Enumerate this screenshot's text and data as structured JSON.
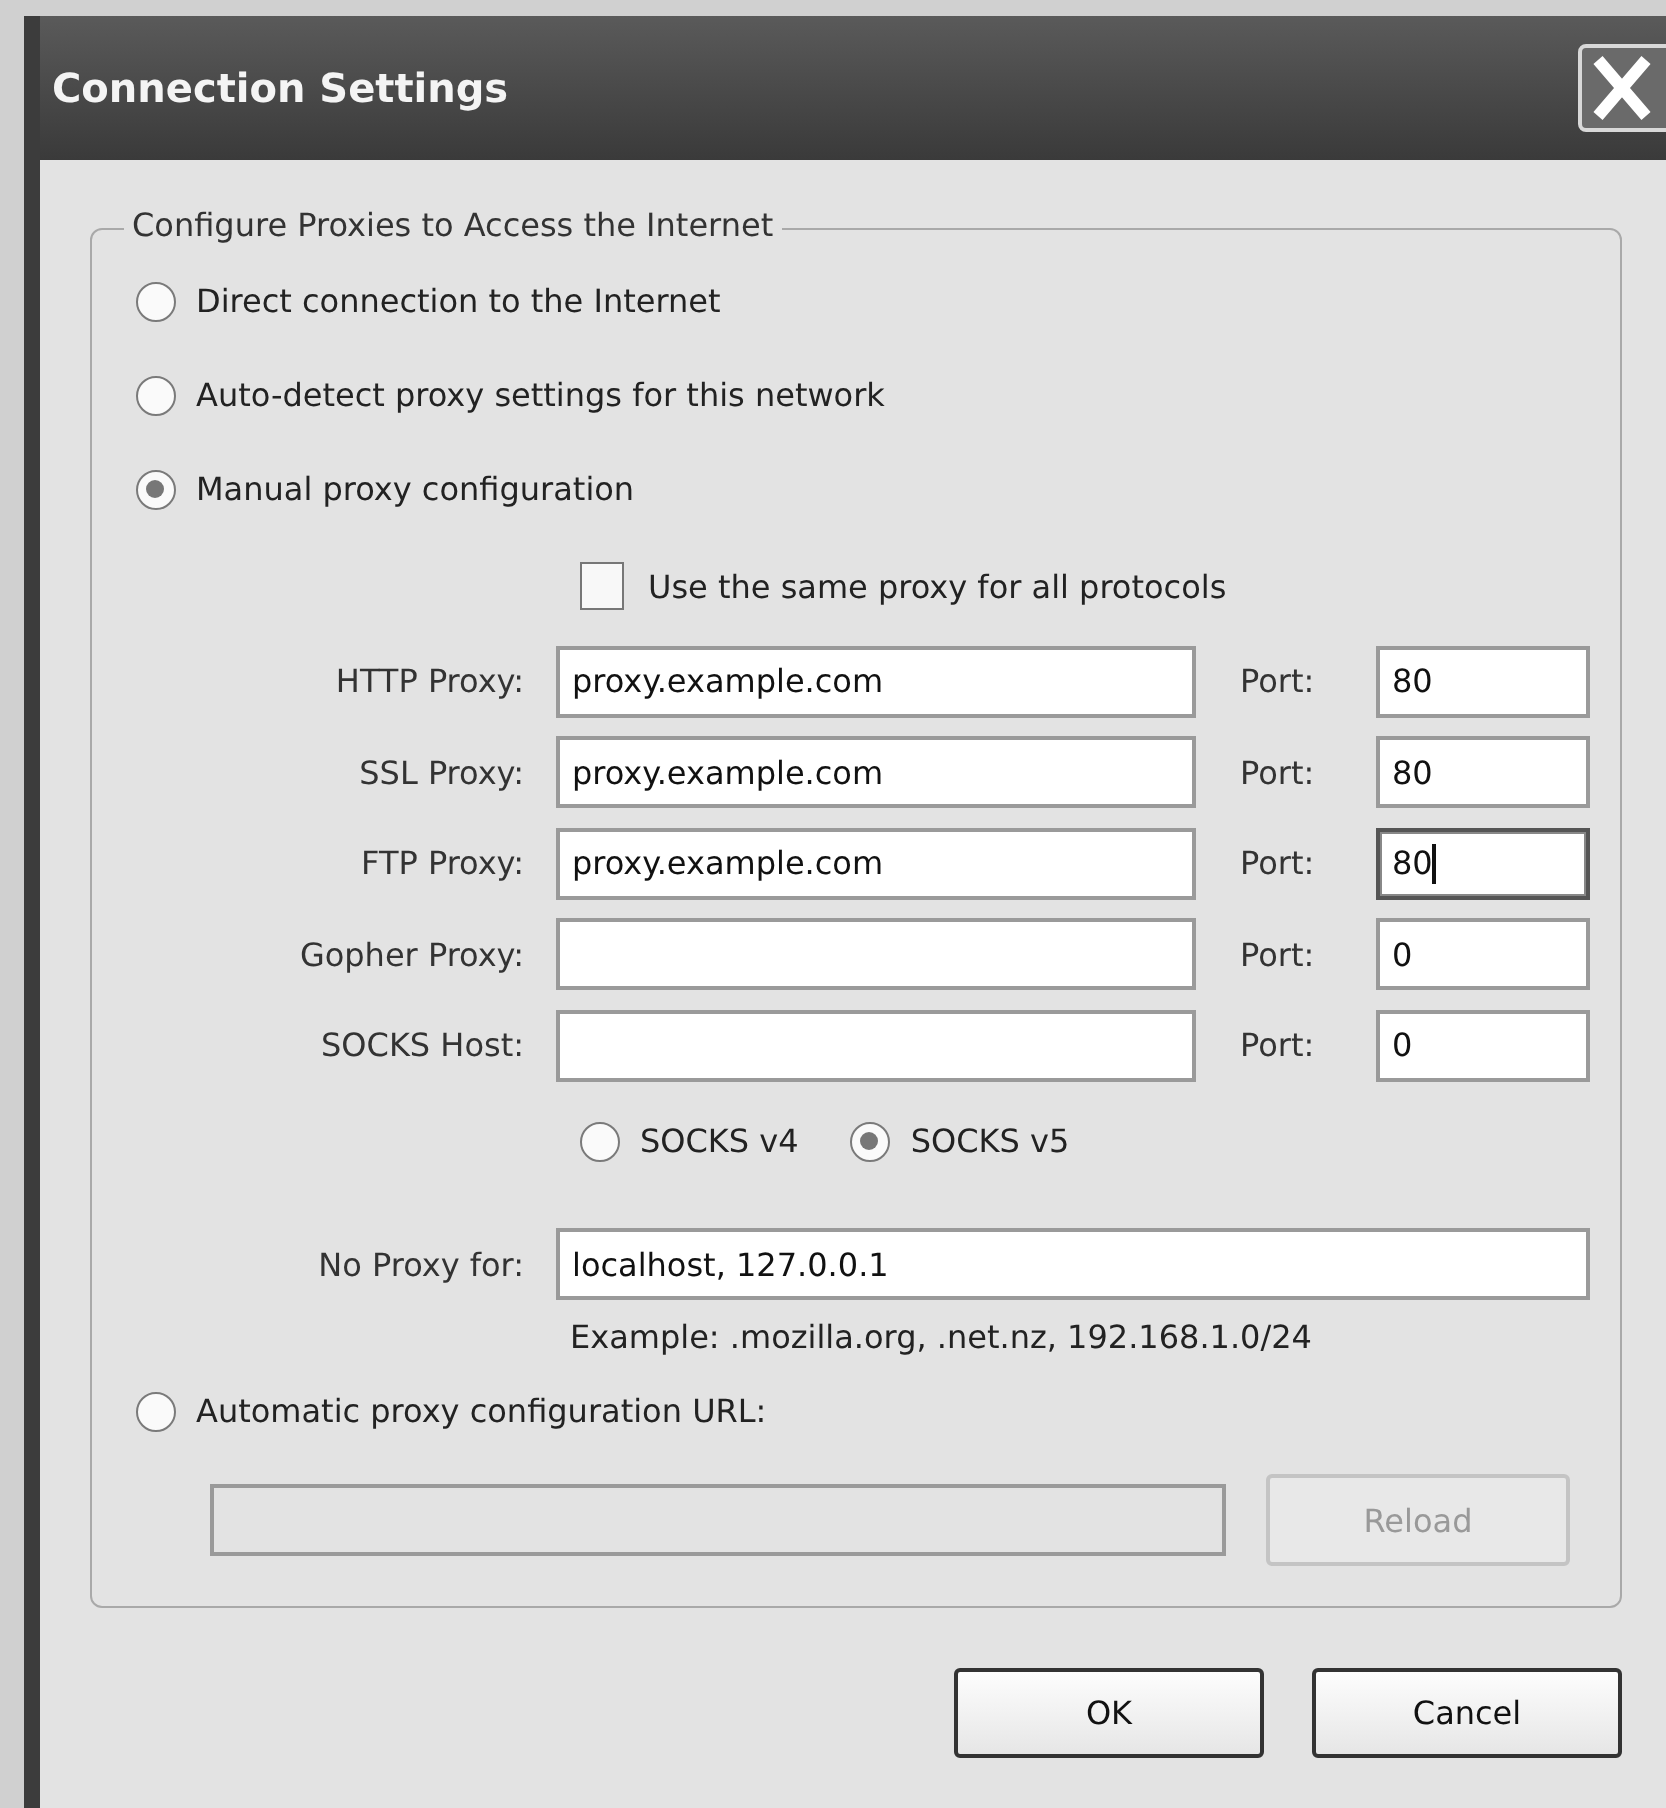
{
  "window": {
    "title": "Connection Settings"
  },
  "group": {
    "legend": "Configure Proxies to Access the Internet"
  },
  "proxy_modes": [
    {
      "label": "Direct connection to the Internet",
      "selected": false
    },
    {
      "label": "Auto-detect proxy settings for this network",
      "selected": false
    },
    {
      "label": "Manual proxy configuration",
      "selected": true
    }
  ],
  "same_proxy": {
    "label": "Use the same proxy for all protocols",
    "checked": false
  },
  "proxies": [
    {
      "label": "HTTP Proxy:",
      "value": "proxy.example.com",
      "port_label": "Port:",
      "port": "80",
      "focused": false
    },
    {
      "label": "SSL Proxy:",
      "value": "proxy.example.com",
      "port_label": "Port:",
      "port": "80",
      "focused": false
    },
    {
      "label": "FTP Proxy:",
      "value": "proxy.example.com",
      "port_label": "Port:",
      "port": "80",
      "focused": true
    },
    {
      "label": "Gopher Proxy:",
      "port_label": "Port:",
      "port": "0",
      "focused": false
    },
    {
      "label": "SOCKS Host:",
      "port_label": "Port:",
      "port": "0",
      "focused": false
    }
  ],
  "socks_versions": [
    {
      "label": "SOCKS v4",
      "selected": false
    },
    {
      "label": "SOCKS v5",
      "selected": true
    }
  ],
  "no_proxy": {
    "label": "No Proxy for:",
    "value": "localhost, 127.0.0.1",
    "example": "Example: .mozilla.org, .net.nz, 192.168.1.0/24"
  },
  "auto_config": {
    "label": "Automatic proxy configuration URL:",
    "selected": false,
    "disabled": true,
    "reload": "Reload"
  },
  "buttons": [
    {
      "label": "OK"
    },
    {
      "label": "Cancel"
    }
  ]
}
